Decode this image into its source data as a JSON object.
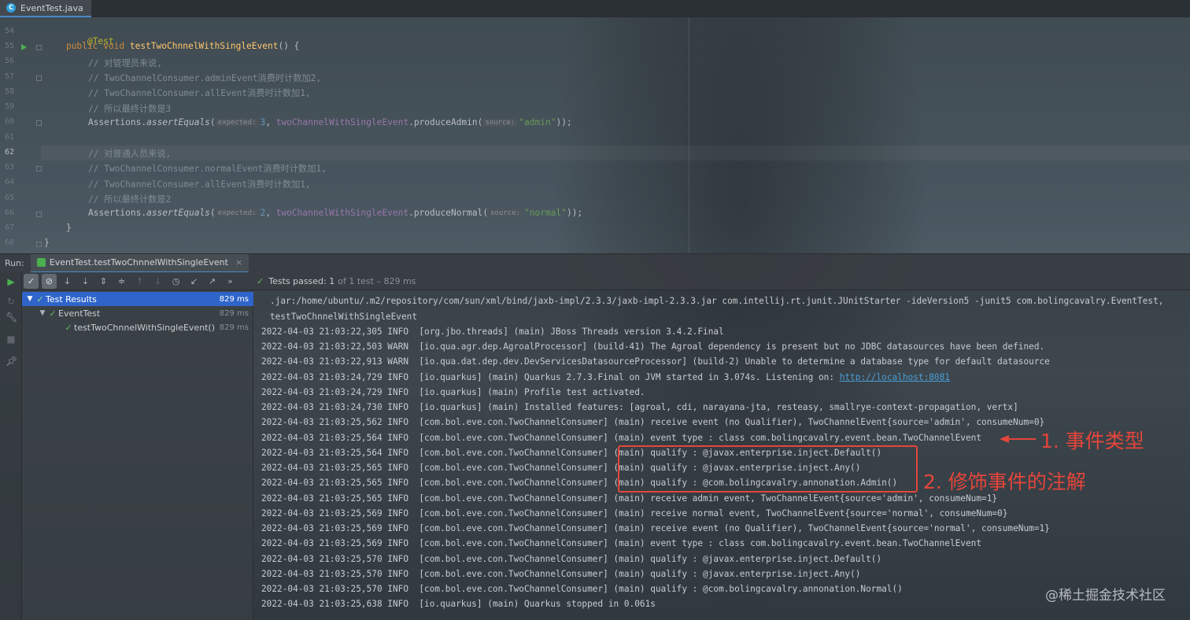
{
  "tab": {
    "file": "EventTest.java"
  },
  "editor": {
    "line_numbers": [
      "54",
      "55",
      "56",
      "57",
      "58",
      "59",
      "60",
      "61",
      "62",
      "63",
      "64",
      "65",
      "66",
      "67",
      "68"
    ],
    "annotation": "@Test",
    "sig_public": "public",
    "sig_void": "void",
    "sig_method": "testTwoChnnelWithSingleEvent",
    "sig_rest": "() {",
    "c1": "// 对管理员来说,",
    "c2": "// TwoChannelConsumer.adminEvent消费时计数加2,",
    "c3": "// TwoChannelConsumer.allEvent消费时计数加1,",
    "c4": "// 所以最终计数是3",
    "a1_class": "Assertions.",
    "a1_method": "assertEquals",
    "hint_expected": "expected:",
    "a1_num": "3",
    "a1_field": "twoChannelWithSingleEvent",
    "a1_call": ".produceAdmin(",
    "hint_source": "source:",
    "a1_str": "\"admin\"",
    "a1_end": "));",
    "c5": "// 对普通人员来说,",
    "c6": "// TwoChannelConsumer.normalEvent消费时计数加1,",
    "c7": "// TwoChannelConsumer.allEvent消费时计数加1,",
    "c8": "// 所以最终计数是2",
    "a2_num": "2",
    "a2_call": ".produceNormal(",
    "a2_str": "\"normal\"",
    "close1": "}",
    "close2": "}"
  },
  "run": {
    "label": "Run:",
    "tab": "EventTest.testTwoChnnelWithSingleEvent",
    "close": "×",
    "status_main": "Tests passed:",
    "status_count": "1",
    "status_rest": "of 1 test – 829 ms"
  },
  "tree": [
    {
      "label": "Test Results",
      "time": "829 ms"
    },
    {
      "label": "EventTest",
      "time": "829 ms"
    },
    {
      "label": "testTwoChnnelWithSingleEvent()",
      "time": "829 ms"
    }
  ],
  "console": {
    "lines": [
      ".jar:/home/ubuntu/.m2/repository/com/sun/xml/bind/jaxb-impl/2.3.3/jaxb-impl-2.3.3.jar com.intellij.rt.junit.JUnitStarter -ideVersion5 -junit5 com.bolingcavalry.EventTest,",
      "testTwoChnnelWithSingleEvent",
      "2022-04-03 21:03:22,305 INFO  [org.jbo.threads] (main) JBoss Threads version 3.4.2.Final",
      "2022-04-03 21:03:22,503 WARN  [io.qua.agr.dep.AgroalProcessor] (build-41) The Agroal dependency is present but no JDBC datasources have been defined.",
      "2022-04-03 21:03:22,913 WARN  [io.qua.dat.dep.dev.DevServicesDatasourceProcessor] (build-2) Unable to determine a database type for default datasource",
      "",
      "2022-04-03 21:03:24,729 INFO  [io.quarkus] (main) Profile test activated.",
      "2022-04-03 21:03:24,730 INFO  [io.quarkus] (main) Installed features: [agroal, cdi, narayana-jta, resteasy, smallrye-context-propagation, vertx]",
      "2022-04-03 21:03:25,562 INFO  [com.bol.eve.con.TwoChannelConsumer] (main) receive event (no Qualifier), TwoChannelEvent{source='admin', consumeNum=0}",
      "2022-04-03 21:03:25,564 INFO  [com.bol.eve.con.TwoChannelConsumer] (main) event type : class com.bolingcavalry.event.bean.TwoChannelEvent",
      "2022-04-03 21:03:25,564 INFO  [com.bol.eve.con.TwoChannelConsumer] (main) qualify : @javax.enterprise.inject.Default()",
      "2022-04-03 21:03:25,565 INFO  [com.bol.eve.con.TwoChannelConsumer] (main) qualify : @javax.enterprise.inject.Any()",
      "2022-04-03 21:03:25,565 INFO  [com.bol.eve.con.TwoChannelConsumer] (main) qualify : @com.bolingcavalry.annonation.Admin()",
      "2022-04-03 21:03:25,565 INFO  [com.bol.eve.con.TwoChannelConsumer] (main) receive admin event, TwoChannelEvent{source='admin', consumeNum=1}",
      "2022-04-03 21:03:25,569 INFO  [com.bol.eve.con.TwoChannelConsumer] (main) receive normal event, TwoChannelEvent{source='normal', consumeNum=0}",
      "2022-04-03 21:03:25,569 INFO  [com.bol.eve.con.TwoChannelConsumer] (main) receive event (no Qualifier), TwoChannelEvent{source='normal', consumeNum=1}",
      "2022-04-03 21:03:25,569 INFO  [com.bol.eve.con.TwoChannelConsumer] (main) event type : class com.bolingcavalry.event.bean.TwoChannelEvent",
      "2022-04-03 21:03:25,570 INFO  [com.bol.eve.con.TwoChannelConsumer] (main) qualify : @javax.enterprise.inject.Default()",
      "2022-04-03 21:03:25,570 INFO  [com.bol.eve.con.TwoChannelConsumer] (main) qualify : @javax.enterprise.inject.Any()",
      "2022-04-03 21:03:25,570 INFO  [com.bol.eve.con.TwoChannelConsumer] (main) qualify : @com.bolingcavalry.annonation.Normal()",
      "2022-04-03 21:03:25,638 INFO  [io.quarkus] (main) Quarkus stopped in 0.061s"
    ],
    "line6_prefix": "2022-04-03 21:03:24,729 INFO  [io.quarkus] (main) Quarkus 2.7.3.Final on JVM started in 3.074s. Listening on: ",
    "line6_link": "http://localhost:8081"
  },
  "annotations": {
    "label1": "1. 事件类型",
    "label2": "2. 修饰事件的注解",
    "color": "#e5453b"
  },
  "watermark": "@稀土掘金技术社区",
  "colors": {
    "accent": "#2f65ca",
    "pass": "#5fb85f"
  }
}
